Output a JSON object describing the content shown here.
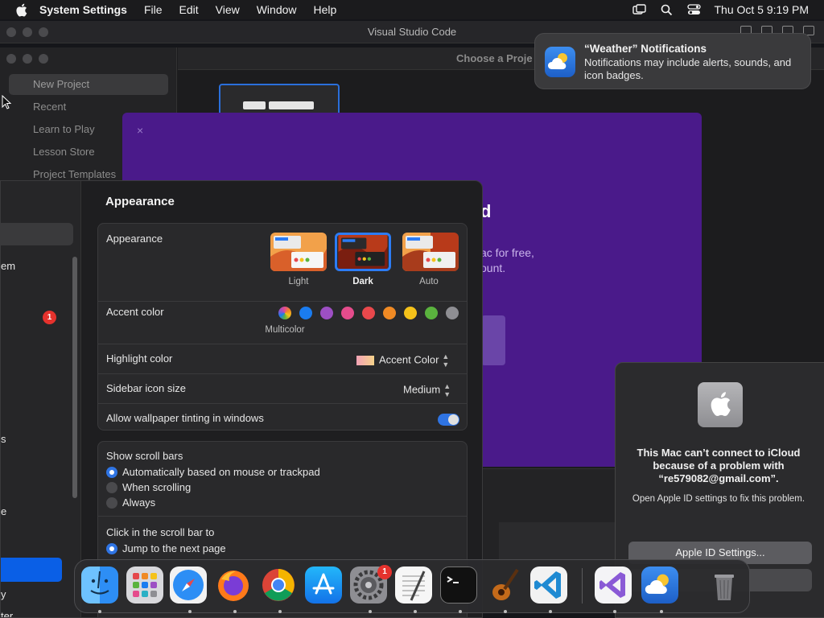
{
  "menubar": {
    "app_name": "System Settings",
    "menus": [
      "File",
      "Edit",
      "View",
      "Window",
      "Help"
    ],
    "clock": "Thu Oct 5  9:19 PM"
  },
  "vscode": {
    "title": "Visual Studio Code"
  },
  "playgrounds": {
    "nav": [
      "New Project",
      "Recent",
      "Learn to Play",
      "Lesson Store",
      "Project Templates"
    ],
    "header": "Choose a Proje",
    "modal_close": "×",
    "modal_heading": "d",
    "modal_sub_1": "ac for free,",
    "modal_sub_2": "ount."
  },
  "notification": {
    "title": "“Weather” Notifications",
    "body": "Notifications may include alerts, sounds, and icon badges."
  },
  "icloud_alert": {
    "message": "This Mac can’t connect to iCloud because of a problem with “re579082@gmail.com”.",
    "sub": "Open Apple ID settings to fix this problem.",
    "button": "Apple ID Settings..."
  },
  "settings": {
    "sidebar": {
      "frag_1": "em",
      "badge": "1",
      "frag_2": "s",
      "frag_3": "e",
      "frag_4": "y",
      "frag_5": "ter"
    },
    "title": "Appearance",
    "appearance": {
      "label": "Appearance",
      "options": [
        "Light",
        "Dark",
        "Auto"
      ],
      "selected": "Dark"
    },
    "accent": {
      "label": "Accent color",
      "caption": "Multicolor",
      "colors": [
        "#8e5ad6",
        "#1a7cf0",
        "#9d4fc4",
        "#e54c8c",
        "#e9484c",
        "#f08a24",
        "#f5c21a",
        "#5ab33e",
        "#8e8e93"
      ]
    },
    "highlight": {
      "label": "Highlight color",
      "value": "Accent Color"
    },
    "sidebar_icon": {
      "label": "Sidebar icon size",
      "value": "Medium"
    },
    "wallpaper_tint": {
      "label": "Allow wallpaper tinting in windows",
      "on": true
    },
    "scroll_bars": {
      "label": "Show scroll bars",
      "options": [
        "Automatically based on mouse or trackpad",
        "When scrolling",
        "Always"
      ]
    },
    "click_scroll": {
      "label": "Click in the scroll bar to",
      "option": "Jump to the next page"
    }
  },
  "dock": {
    "apps": [
      "finder",
      "launchpad",
      "safari",
      "firefox",
      "chrome",
      "app-store",
      "system-settings",
      "textedit",
      "terminal",
      "garageband",
      "vscode",
      "visual-studio",
      "weather",
      "trash"
    ],
    "settings_badge": "1"
  }
}
